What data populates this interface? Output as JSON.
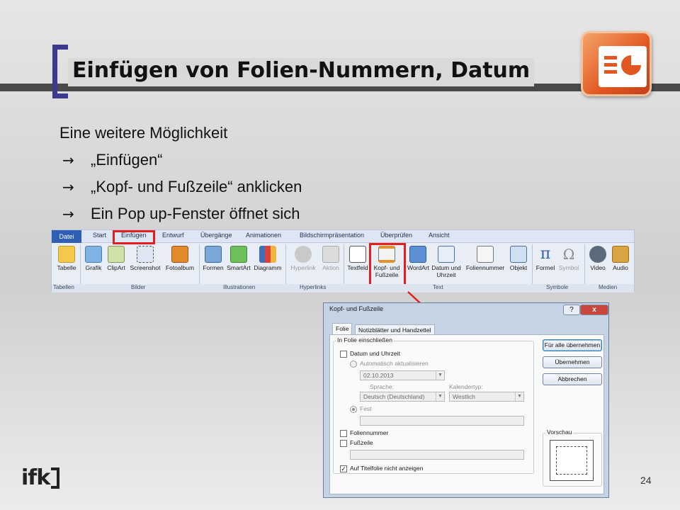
{
  "slide": {
    "title": "Einfügen von Folien-Nummern, Datum",
    "intro": "Eine weitere Möglichkeit",
    "arrow_glyph": "→",
    "bullets": [
      "„Einfügen“",
      "„Kopf- und Fußzeile“ anklicken",
      "Ein Pop up-Fenster öffnet sich"
    ],
    "page_number": "24",
    "logo_text": "ifk"
  },
  "ribbon": {
    "tabs": [
      "Datei",
      "Start",
      "Einfügen",
      "Entwurf",
      "Übergänge",
      "Animationen",
      "Bildschirmpräsentation",
      "Überprüfen",
      "Ansicht"
    ],
    "groups": {
      "tabellen": {
        "label": "Tabellen",
        "buttons": [
          "Tabelle"
        ]
      },
      "bilder": {
        "label": "Bilder",
        "buttons": [
          "Grafik",
          "ClipArt",
          "Screenshot",
          "Fotoalbum"
        ]
      },
      "illustrationen": {
        "label": "Illustrationen",
        "buttons": [
          "Formen",
          "SmartArt",
          "Diagramm"
        ]
      },
      "hyperlinks": {
        "label": "Hyperlinks",
        "buttons": [
          "Hyperlink",
          "Aktion"
        ]
      },
      "text": {
        "label": "Text",
        "buttons": [
          "Textfeld",
          "Kopf- und",
          "Fußzeile",
          "WordArt",
          "Datum und",
          "Uhrzeit",
          "Foliennummer",
          "Objekt"
        ]
      },
      "symbole": {
        "label": "Symbole",
        "buttons": [
          "Formel",
          "Symbol"
        ]
      },
      "medien": {
        "label": "Medien",
        "buttons": [
          "Video",
          "Audio"
        ]
      }
    }
  },
  "dialog": {
    "title": "Kopf- und Fußzeile",
    "title_buttons": [
      "?",
      "x"
    ],
    "tabs": [
      "Folie",
      "Notizblätter und Handzettel"
    ],
    "section_label": "In Folie einschließen",
    "datum_checkbox": "Datum und Uhrzeit",
    "auto_radio": "Automatisch aktualisieren",
    "date_value": "02.10.2013",
    "sprache_label": "Sprache:",
    "sprache_value": "Deutsch (Deutschland)",
    "kalender_label": "Kalendertyp:",
    "kalender_value": "Westlich",
    "fest_radio": "Fest",
    "foliennummer": "Foliennummer",
    "fusszeile": "Fußzeile",
    "titelfolie": "Auf Titelfolie nicht anzeigen",
    "titelfolie_checked_glyph": "✓",
    "buttons": [
      "Für alle übernehmen",
      "Übernehmen",
      "Abbrechen"
    ],
    "vorschau_label": "Vorschau"
  },
  "colors": {
    "accent_red": "#e41e1e",
    "bracket_blue": "#3b3a8f",
    "ppt_orange": "#e2561f"
  }
}
